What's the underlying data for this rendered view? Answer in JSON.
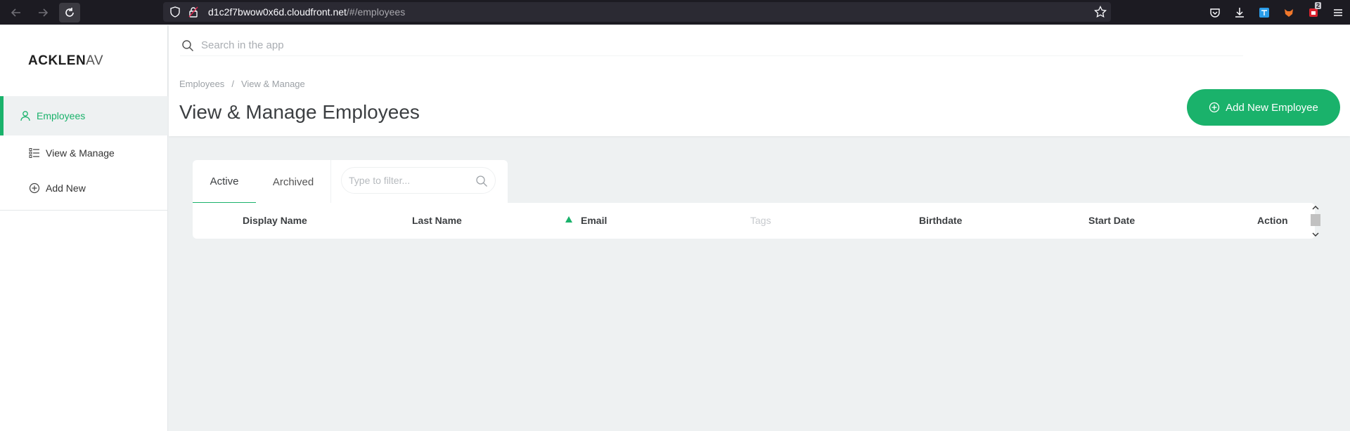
{
  "browser": {
    "url_host": "d1c2f7bwow0x6d.cloudfront.net",
    "url_path": "/#/employees",
    "extension_badge": "2"
  },
  "sidebar": {
    "logo_main": "ACKLEN",
    "logo_tail": "AV",
    "items": [
      {
        "label": "Employees",
        "icon": "user-icon",
        "active": true
      },
      {
        "label": "View & Manage",
        "icon": "list-icon"
      },
      {
        "label": "Add New",
        "icon": "plus-circle-icon"
      }
    ]
  },
  "header": {
    "search_placeholder": "Search in the app",
    "breadcrumb": [
      "Employees",
      "View & Manage"
    ],
    "breadcrumb_separator": "/",
    "title": "View & Manage Employees",
    "add_button_label": "Add New Employee"
  },
  "content": {
    "tabs": [
      "Active",
      "Archived"
    ],
    "active_tab": "Active",
    "filter_placeholder": "Type to filter...",
    "columns": [
      {
        "label": "Display Name"
      },
      {
        "label": "Last Name"
      },
      {
        "label": "Email",
        "sorted": "ascending"
      },
      {
        "label": "Tags",
        "disabled": true
      },
      {
        "label": "Birthdate"
      },
      {
        "label": "Start Date"
      },
      {
        "label": "Action"
      }
    ],
    "rows": []
  },
  "colors": {
    "accent": "#1ab26b",
    "background": "#eef1f2",
    "browser_chrome": "#1c1b22"
  }
}
